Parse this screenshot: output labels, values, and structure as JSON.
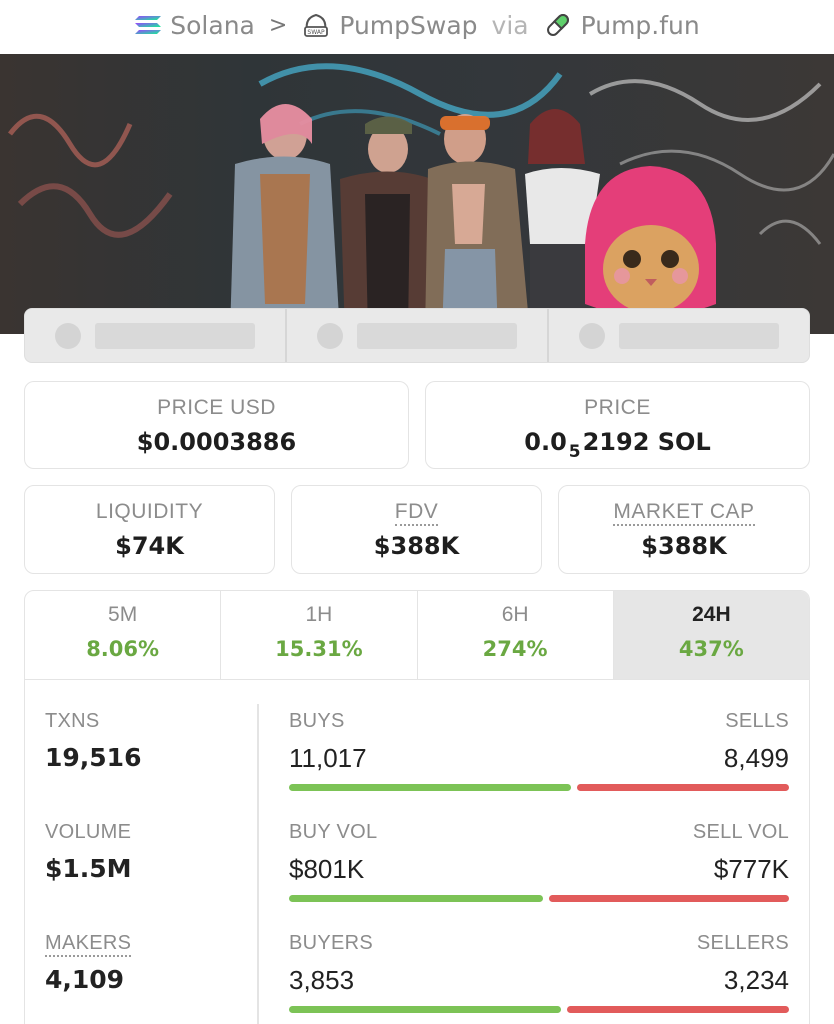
{
  "breadcrumb": {
    "chain": "Solana",
    "separator": ">",
    "dex": "PumpSwap",
    "via": "via",
    "launchpad": "Pump.fun",
    "icons": [
      "solana-icon",
      "pumpswap-icon",
      "pill-icon"
    ]
  },
  "stats": {
    "price_usd": {
      "label": "PRICE USD",
      "value": "$0.0003886"
    },
    "price": {
      "label": "PRICE",
      "value_prefix": "0.0",
      "value_subscript": "5",
      "value_suffix": "2192 SOL"
    },
    "liquidity": {
      "label": "LIQUIDITY",
      "value": "$74K"
    },
    "fdv": {
      "label": "FDV",
      "value": "$388K"
    },
    "market_cap": {
      "label": "MARKET CAP",
      "value": "$388K"
    }
  },
  "timeframes": [
    {
      "label": "5M",
      "change": "8.06%"
    },
    {
      "label": "1H",
      "change": "15.31%"
    },
    {
      "label": "6H",
      "change": "274%"
    },
    {
      "label": "24H",
      "change": "437%",
      "active": true
    }
  ],
  "metrics": {
    "txns": {
      "label": "TXNS",
      "value": "19,516"
    },
    "volume": {
      "label": "VOLUME",
      "value": "$1.5M"
    },
    "makers": {
      "label": "MAKERS",
      "value": "4,109"
    },
    "buys_sells": {
      "left_label": "BUYS",
      "left_value": "11,017",
      "right_label": "SELLS",
      "right_value": "8,499",
      "buy_fraction": 0.5645
    },
    "volumes": {
      "left_label": "BUY VOL",
      "left_value": "$801K",
      "right_label": "SELL VOL",
      "right_value": "$777K",
      "buy_fraction": 0.5076
    },
    "makers_split": {
      "left_label": "BUYERS",
      "left_value": "3,853",
      "right_label": "SELLERS",
      "right_value": "3,234",
      "buy_fraction": 0.5437
    }
  },
  "colors": {
    "positive": "#6aa842",
    "buy_bar": "#7cc356",
    "sell_bar": "#e25b5b",
    "active_tab": "#e6e6e6"
  }
}
